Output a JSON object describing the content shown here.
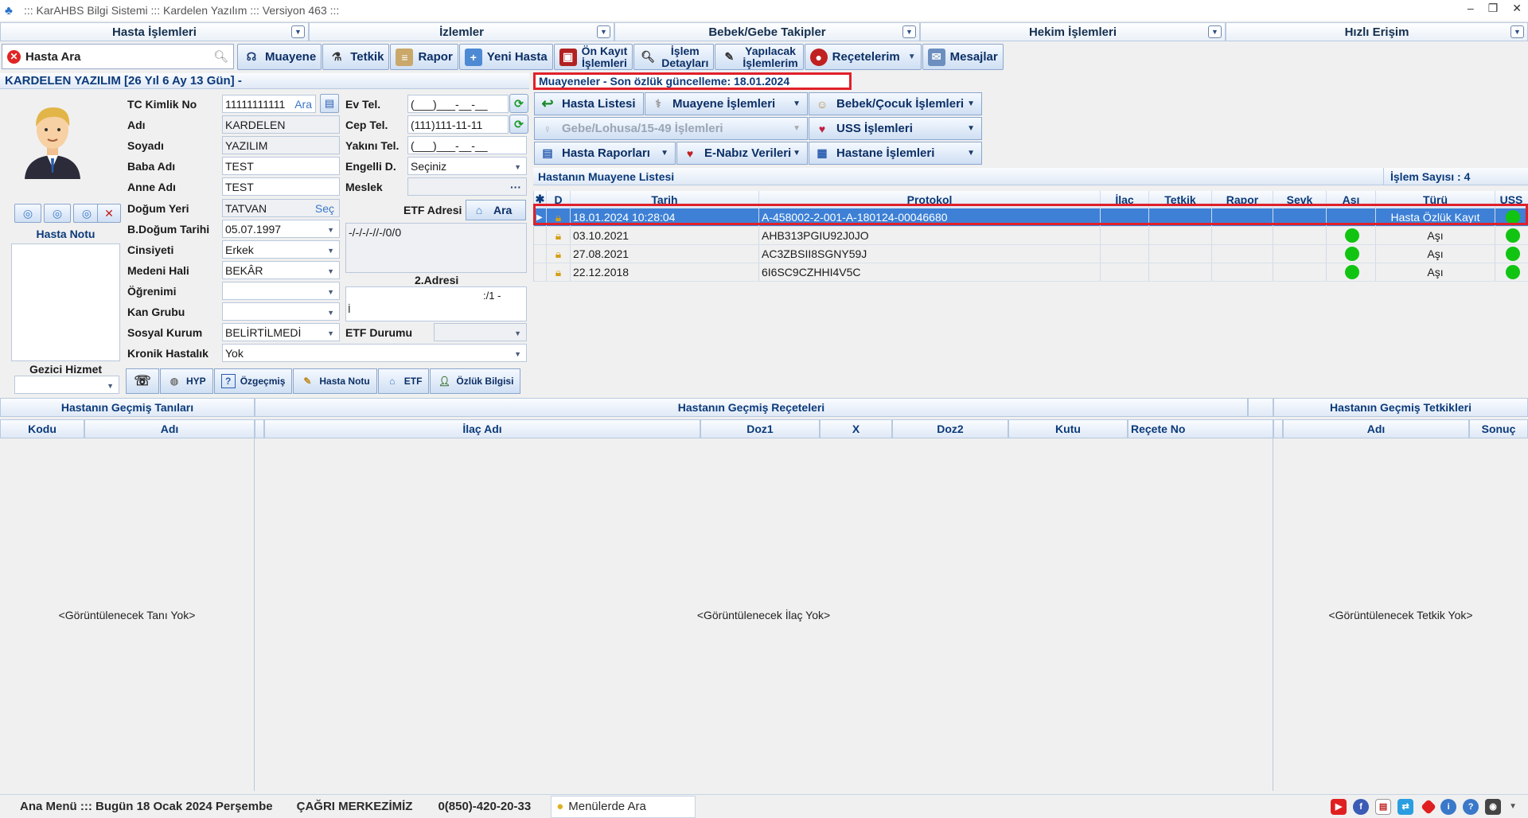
{
  "window": {
    "title": "::: KarAHBS  Bilgi Sistemi ::: Kardelen Yazılım ::: Versiyon 463 :::",
    "min": "–",
    "max": "❐",
    "close": "✕"
  },
  "menu": [
    "Hasta İşlemleri",
    "İzlemler",
    "Bebek/Gebe Takipler",
    "Hekim İşlemleri",
    "Hızlı Erişim"
  ],
  "search": {
    "placeholder": "Hasta Ara"
  },
  "toolbar": {
    "muayene": "Muayene",
    "tetkik": "Tetkik",
    "rapor": "Rapor",
    "yeni_hasta": "Yeni Hasta",
    "on_kayit_1": "Ön Kayıt",
    "on_kayit_2": "İşlemleri",
    "islem_1": "İşlem",
    "islem_2": "Detayları",
    "yapilacak_1": "Yapılacak",
    "yapilacak_2": "İşlemlerim",
    "receteler": "Reçetelerim",
    "mesajlar": "Mesajlar"
  },
  "patient": {
    "header": "KARDELEN YAZILIM  [26 Yıl  6 Ay 13 Gün] -"
  },
  "muayene_header": "Muayeneler - Son özlük güncelleme: 18.01.2024",
  "form": {
    "tc_label": "TC Kimlik No",
    "tc": "11111111111",
    "ara": "Ara",
    "adi_label": "Adı",
    "adi": "KARDELEN",
    "soyadi_label": "Soyadı",
    "soyadi": "YAZILIM",
    "baba_label": "Baba Adı",
    "baba": "TEST",
    "anne_label": "Anne Adı",
    "anne": "TEST",
    "dogum_yeri_label": "Doğum Yeri",
    "dogum_yeri": "TATVAN",
    "sec": "Seç",
    "dogum_tarihi_label": "B.Doğum Tarihi",
    "dogum_tarihi": "05.07.1997",
    "cinsiyet_label": "Cinsiyeti",
    "cinsiyet": "Erkek",
    "medeni_label": "Medeni Hali",
    "medeni": "BEKÂR",
    "ogrenim_label": "Öğrenimi",
    "ogrenim": "",
    "kan_label": "Kan Grubu",
    "kan": "",
    "sosyal_label": "Sosyal Kurum",
    "sosyal": "BELİRTİLMEDİ",
    "kronik_label": "Kronik Hastalık",
    "kronik": "Yok",
    "evtel_label": "Ev Tel.",
    "evtel": "(___)___-__-__",
    "ceptel_label": "Cep Tel.",
    "ceptel": "(111)111-11-11",
    "yakintel_label": "Yakını Tel.",
    "yakintel": "(___)___-__-__",
    "engelli_label": "Engelli D.",
    "engelli": "Seçiniz",
    "meslek_label": "Meslek",
    "meslek_dots": "···",
    "etf_label": "ETF Adresi",
    "etf_ara": "Ara",
    "adres": "-/-/-/-//-/0/0",
    "adres2_label": "2.Adresi",
    "adres2": ":/1 -",
    "adres2_b": "İ",
    "etf_durum_label": "ETF Durumu"
  },
  "hasta_notu_label": "Hasta Notu",
  "gezici_label": "Gezici Hizmet",
  "tabs": {
    "hyp": "HYP",
    "ozgecmis": "Özgeçmiş",
    "hasta_notu": "Hasta Notu",
    "etf": "ETF",
    "ozluk": "Özlük Bilgisi"
  },
  "actions": {
    "hasta_listesi": "Hasta Listesi",
    "muayene_islemleri": "Muayene İşlemleri",
    "bebek_cocuk": "Bebek/Çocuk İşlemleri",
    "gebe": "Gebe/Lohusa/15-49 İşlemleri",
    "uss": "USS İşlemleri",
    "hasta_raporlari": "Hasta Raporları",
    "enabiz": "E-Nabız Verileri",
    "hastane": "Hastane İşlemleri"
  },
  "list": {
    "title": "Hastanın Muayene Listesi",
    "count": "İşlem Sayısı : 4",
    "columns": [
      "D",
      "Tarih",
      "Protokol",
      "İlaç",
      "Tetkik",
      "Rapor",
      "Sevk",
      "Aşı",
      "Türü",
      "USS"
    ],
    "rows": [
      {
        "tarih": "18.01.2024 10:28:04",
        "protokol": "A-458002-2-001-A-180124-00046680",
        "asi": false,
        "turu": "Hasta Özlük Kayıt",
        "uss": true
      },
      {
        "tarih": "03.10.2021",
        "protokol": "AHB313PGIU92J0JO",
        "asi": true,
        "turu": "Aşı",
        "uss": true
      },
      {
        "tarih": "27.08.2021",
        "protokol": "AC3ZBSII8SGNY59J",
        "asi": true,
        "turu": "Aşı",
        "uss": true
      },
      {
        "tarih": "22.12.2018",
        "protokol": "6I6SC9CZHHI4V5C",
        "asi": true,
        "turu": "Aşı",
        "uss": true
      }
    ]
  },
  "bottom": {
    "tanilar_title": "Hastanın Geçmiş Tanıları",
    "tani_kodu": "Kodu",
    "tani_adi": "Adı",
    "tani_empty": "<Görüntülenecek Tanı Yok>",
    "receteler_title": "Hastanın Geçmiş Reçeteleri",
    "ilac_adi": "İlaç Adı",
    "doz1": "Doz1",
    "x": "X",
    "doz2": "Doz2",
    "kutu": "Kutu",
    "recete_no": "Reçete No",
    "ilac_empty": "<Görüntülenecek İlaç Yok>",
    "tetkikler_title": "Hastanın Geçmiş Tetkikleri",
    "tetkik_adi": "Adı",
    "sonuc": "Sonuç",
    "tetkik_empty": "<Görüntülenecek Tetkik Yok>"
  },
  "status": {
    "menu": "Ana Menü ::: Bugün 18 Ocak 2024 Perşembe",
    "cagri": "ÇAĞRI MERKEZİMİZ",
    "phone": "0(850)-420-20-33",
    "menu_search": "Menülerde Ara"
  }
}
